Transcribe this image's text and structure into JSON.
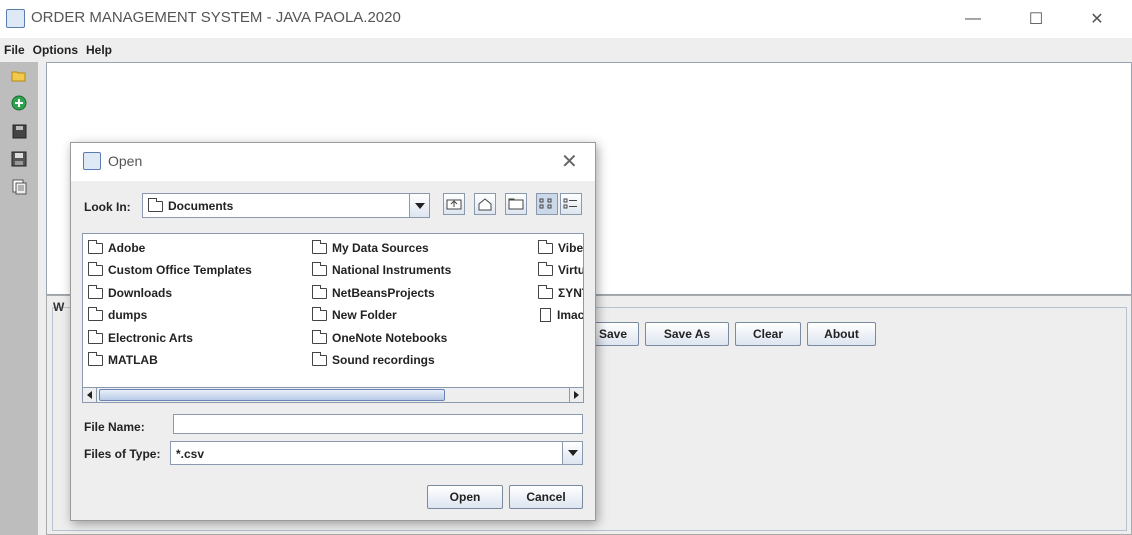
{
  "window": {
    "title": "ORDER MANAGEMENT SYSTEM - JAVA PAOLA.2020",
    "controls": {
      "minimize": "—",
      "maximize": "☐",
      "close": "✕"
    }
  },
  "menu": [
    "File",
    "Options",
    "Help"
  ],
  "toolbar": {
    "icons": [
      "open-folder-icon",
      "add-icon",
      "save-icon",
      "save-as-icon",
      "document-icon"
    ]
  },
  "panel": {
    "label_fragment": "W",
    "buttons": {
      "save": "Save",
      "save_as": "Save As",
      "clear": "Clear",
      "about": "About"
    }
  },
  "dialog": {
    "title": "Open",
    "close": "✕",
    "look_in_label": "Look In:",
    "look_in_value": "Documents",
    "file_name_label": "File Name:",
    "file_name_value": "",
    "files_of_type_label": "Files of Type:",
    "files_of_type_value": "*.csv",
    "open_button": "Open",
    "cancel_button": "Cancel",
    "files": {
      "col1": [
        "Adobe",
        "Custom Office Templates",
        "Downloads",
        "dumps",
        "Electronic Arts",
        "MATLAB"
      ],
      "col2": [
        "My Data Sources",
        "National Instruments",
        "NetBeansProjects",
        "New Folder",
        "OneNote Notebooks",
        "Sound recordings"
      ],
      "col3": [
        "Vibe",
        "Virtu",
        "ΣΥΝΤ",
        "Imac"
      ]
    }
  }
}
